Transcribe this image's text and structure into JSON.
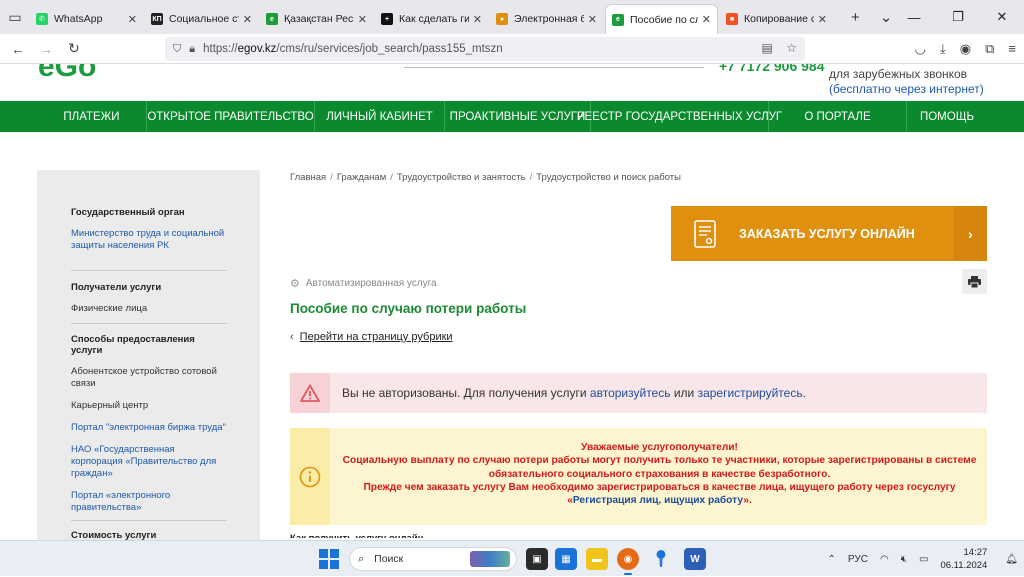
{
  "browser": {
    "tabs": [
      {
        "label": "WhatsApp",
        "icon": "whatsapp-icon",
        "color": "#25d366",
        "glyph": "✆",
        "active": false
      },
      {
        "label": "Социальное стр",
        "icon": "kp-site-icon",
        "color": "#222222",
        "glyph": "КП",
        "active": false
      },
      {
        "label": "Қазақстан Респу",
        "icon": "egov-icon",
        "color": "#1c9c3d",
        "glyph": "e",
        "active": false
      },
      {
        "label": "Как сделать гипе",
        "icon": "plus-site-icon",
        "color": "#111111",
        "glyph": "+",
        "active": false
      },
      {
        "label": "Электронная биж",
        "icon": "enbek-icon",
        "color": "#e0900f",
        "glyph": "●",
        "active": false
      },
      {
        "label": "Пособие по случ",
        "icon": "egov-icon",
        "color": "#1c9c3d",
        "glyph": "e",
        "active": true
      },
      {
        "label": "Копирование со",
        "icon": "microsoft-icon",
        "color": "#f25022",
        "glyph": "■",
        "active": false
      }
    ],
    "url_prefix": "https://",
    "url_host": "egov.kz",
    "url_path": "/cms/ru/services/job_search/pass155_mtszn"
  },
  "header": {
    "phone": "+7 7172 906 984",
    "phone_note": "для зарубежных звонков",
    "phone_note2": "(бесплатно через интернет)"
  },
  "menu": [
    {
      "label": "ПЛАТЕЖИ",
      "w": 110
    },
    {
      "label": "ОТКРЫТОЕ ПРАВИТЕЛЬСТВО",
      "w": 168
    },
    {
      "label": "ЛИЧНЫЙ КАБИНЕТ",
      "w": 130
    },
    {
      "label": "ПРОАКТИВНЫЕ УСЛУГИ",
      "w": 146
    },
    {
      "label": "РЕЕСТР ГОСУДАРСТВЕННЫХ УСЛУГ",
      "w": 178
    },
    {
      "label": "О ПОРТАЛЕ",
      "w": 138
    },
    {
      "label": "ПОМОЩЬ",
      "w": 80
    }
  ],
  "sidebar": {
    "gov_body_title": "Государственный орган",
    "gov_body_link": "Министерство труда и социальной защиты населения РК",
    "recipients_title": "Получатели услуги",
    "recipients_value": "Физические лица",
    "methods_title": "Способы предоставления услуги",
    "methods": [
      {
        "label": "Абонентское устройство сотовой связи",
        "link": false
      },
      {
        "label": "Карьерный центр",
        "link": false
      },
      {
        "label": "Портал \"электронная биржа труда\"",
        "link": true
      },
      {
        "label": "НАО «Государственная корпорация «Правительство для граждан»",
        "link": true
      },
      {
        "label": "Портал «электронного правительства»",
        "link": true
      }
    ],
    "cost_title": "Стоимость услуги"
  },
  "breadcrumb": [
    "Главная",
    "Гражданам",
    "Трудоустройство и занятость",
    "Трудоустройство и поиск работы"
  ],
  "order_button": "ЗАКАЗАТЬ УСЛУГУ ОНЛАЙН",
  "service_type": "Автоматизированная услуга",
  "page_title": "Пособие по случаю потери работы",
  "back_link": "Перейти на страницу рубрики",
  "auth_alert": {
    "text_before": "Вы не авторизованы. Для получения услуги ",
    "login_link": "авторизуйтесь",
    "text_mid": " или ",
    "register_link": "зарегистрируйтесь",
    "text_after": "."
  },
  "warning": {
    "line1": "Уважаемые услугополучатели!",
    "line2": "Социальную выплату по случаю потери работы могут получить только те участники, которые зарегистрированы в системе обязательного социального страхования в качестве безработного.",
    "line3": "Прежде чем заказать услугу Вам необходимо зарегистрироваться в качестве лица, ищущего работу через госуслугу",
    "link_open": "«",
    "link": "Регистрация лиц, ищущих работу",
    "link_close": "».",
    "color": "#d11a1a"
  },
  "cut_text": "Как получить услугу онлайн",
  "taskbar": {
    "search_placeholder": "Поиск",
    "lang": "РУС",
    "time": "14:27",
    "date": "06.11.2024"
  },
  "colors": {
    "brand_green": "#0b8a2d",
    "order_orange": "#e0900f",
    "link_blue": "#1e5aa8"
  }
}
